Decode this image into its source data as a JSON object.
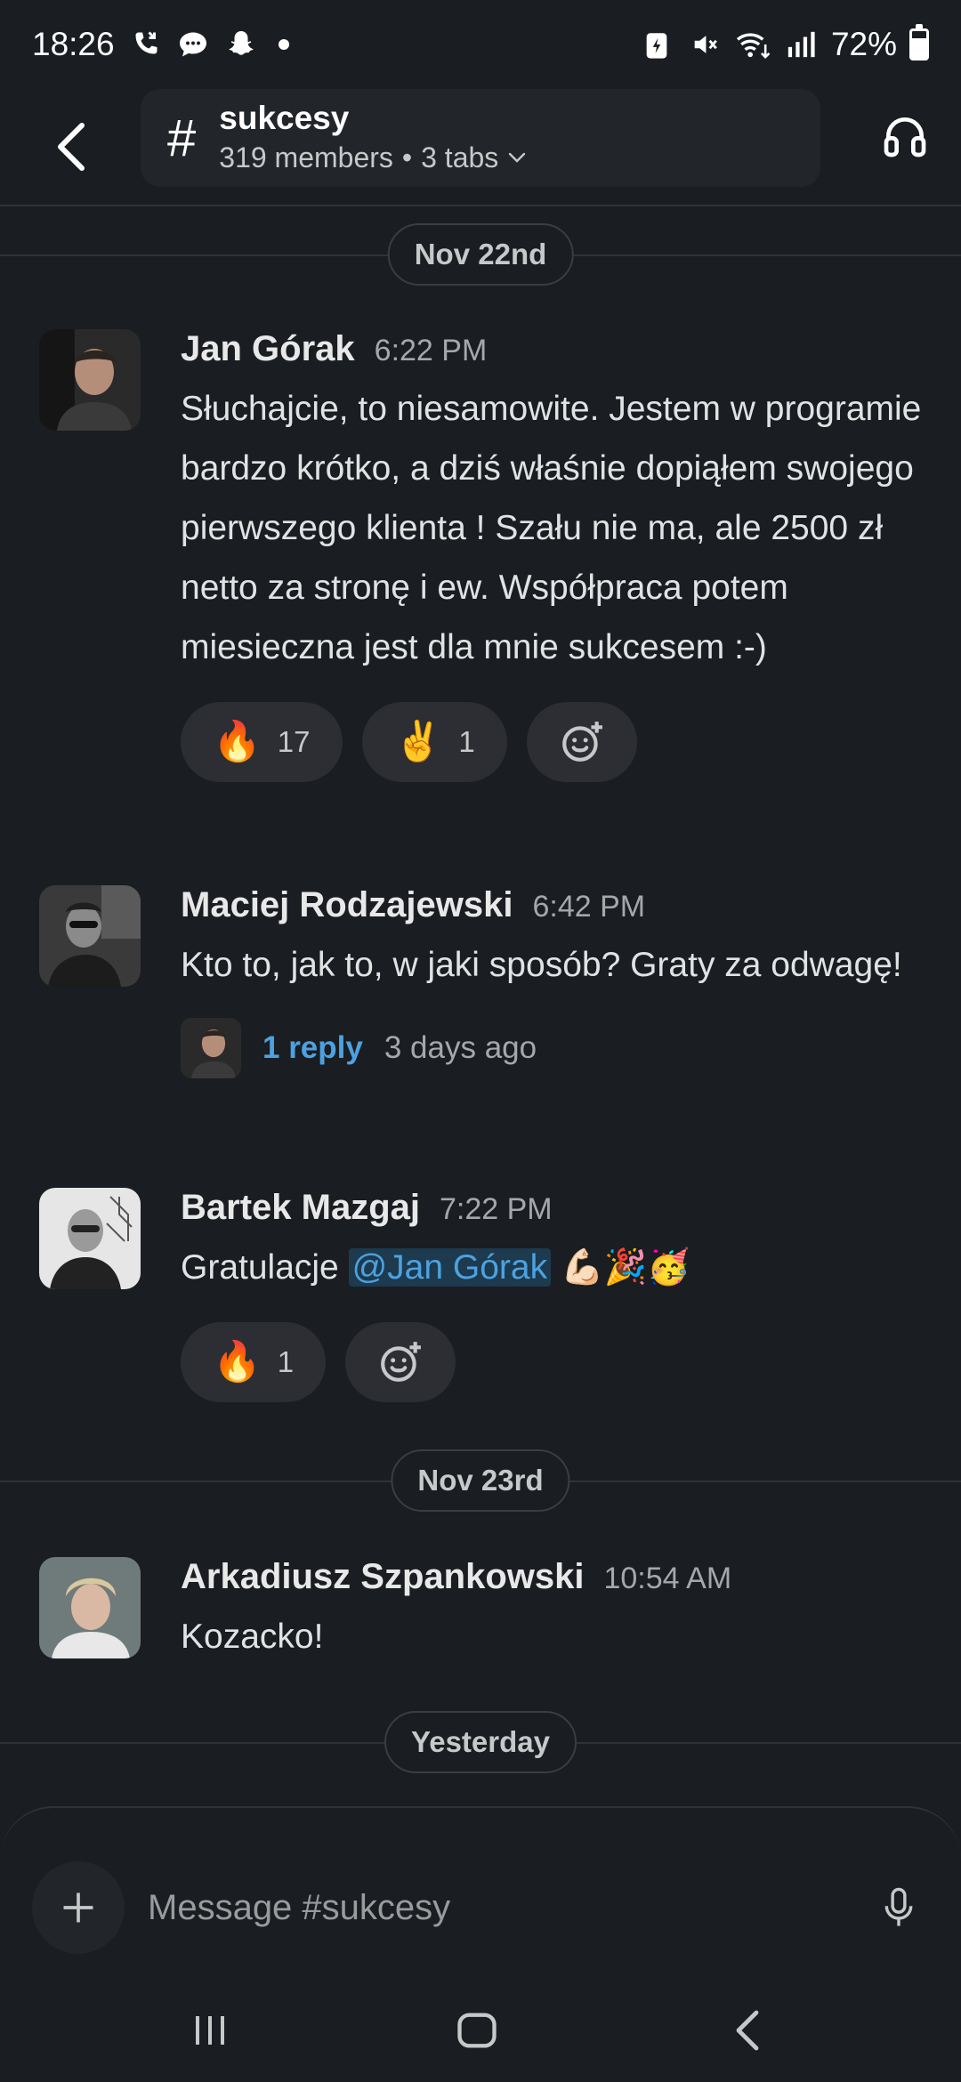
{
  "status_bar": {
    "time": "18:26",
    "battery": "72%",
    "battery_level": 0.72,
    "left_icons": [
      "missed-call-icon",
      "chat-bubble-icon",
      "snapchat-icon",
      "notification-dot-icon"
    ],
    "right_icons": [
      "battery-saver-icon",
      "mute-icon",
      "wifi-icon",
      "signal-icon",
      "battery-icon"
    ]
  },
  "header": {
    "channel_name": "sukcesy",
    "members": "319 members",
    "separator": "•",
    "tabs": "3 tabs"
  },
  "dates": {
    "nov22": "Nov 22nd",
    "nov23": "Nov 23rd",
    "yesterday": "Yesterday"
  },
  "messages": [
    {
      "author": "Jan Górak",
      "time": "6:22 PM",
      "text": "Słuchajcie, to niesamowite. Jestem w programie bardzo krótko, a dziś właśnie dopiąłem swojego pierwszego klienta ! Szału nie ma, ale 2500 zł netto za stronę i ew. Współpraca potem miesieczna jest dla mnie sukcesem :-)",
      "reactions": [
        {
          "emoji": "🔥",
          "count": "17"
        },
        {
          "emoji": "✌️",
          "count": "1"
        }
      ]
    },
    {
      "author": "Maciej Rodzajewski",
      "time": "6:42 PM",
      "text": "Kto to, jak to, w jaki sposób? Graty za odwagę!",
      "thread": {
        "replies": "1 reply",
        "when": "3 days ago"
      }
    },
    {
      "author": "Bartek Mazgaj",
      "time": "7:22 PM",
      "text_prefix": "Gratulacje ",
      "mention": "@Jan Górak",
      "text_suffix": " 💪🏻🎉🥳",
      "reactions": [
        {
          "emoji": "🔥",
          "count": "1"
        }
      ]
    },
    {
      "author": "Arkadiusz Szpankowski",
      "time": "10:54 AM",
      "text": "Kozacko!"
    }
  ],
  "composer": {
    "placeholder": "Message #sukcesy"
  },
  "colors": {
    "background": "#1a1d21",
    "link": "#4ca2e0",
    "reaction_bg": "#2c2e33"
  }
}
